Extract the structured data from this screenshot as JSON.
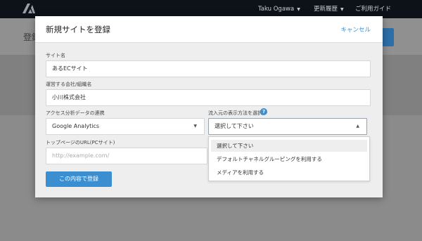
{
  "topbar": {
    "user_label": "Taku Ogawa",
    "history_label": "更新履歴",
    "guide_label": "ご利用ガイド"
  },
  "page": {
    "title_partial": "登録"
  },
  "modal": {
    "title": "新規サイトを登録",
    "cancel_label": "キャンセル",
    "site_name": {
      "label": "サイト名",
      "value": "あるECサイト"
    },
    "company": {
      "label": "運営する会社/組織名",
      "value": "小川株式会社"
    },
    "analytics": {
      "label": "アクセス分析データの連携",
      "value": "Google Analytics"
    },
    "traffic_display": {
      "label": "流入元の表示方法を選択",
      "value": "選択して下さい"
    },
    "top_url": {
      "label": "トップページのURL(PCサイト)",
      "placeholder": "http://example.com/"
    },
    "submit_label": "この内容で登録",
    "dropdown_options": [
      "選択して下さい",
      "デフォルトチャネルグルーピングを利用する",
      "メディアを利用する"
    ]
  },
  "colors": {
    "accent": "#3b8fd0",
    "topbar": "#0d1219",
    "modal_bg": "#eeeeee"
  },
  "icons": {
    "logo": "logo-icon",
    "help": "help-icon",
    "caret": "caret-down-icon"
  }
}
